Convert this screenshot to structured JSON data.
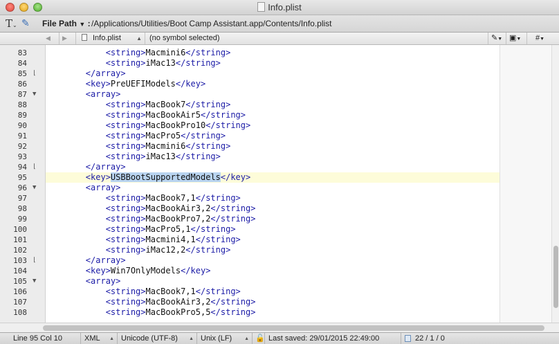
{
  "window": {
    "title": "Info.plist"
  },
  "pathbar": {
    "label": "File Path",
    "separator": ":",
    "value": "/Applications/Utilities/Boot Camp Assistant.app/Contents/Info.plist"
  },
  "navbar": {
    "back_arrow": "◀",
    "forward_arrow": "▶",
    "file": "Info.plist",
    "symbol": "(no symbol selected)",
    "right_tools": [
      "✎",
      "▣",
      "#"
    ]
  },
  "lines": [
    {
      "num": "83",
      "fold": "",
      "indent": "        ",
      "open": "<string>",
      "content": "Macmini6",
      "close": "</string>"
    },
    {
      "num": "84",
      "fold": "",
      "indent": "        ",
      "open": "<string>",
      "content": "iMac13",
      "close": "</string>"
    },
    {
      "num": "85",
      "fold": "⌊",
      "indent": "    ",
      "open": "</array>",
      "content": "",
      "close": ""
    },
    {
      "num": "86",
      "fold": "",
      "indent": "    ",
      "open": "<key>",
      "content": "PreUEFIModels",
      "close": "</key>"
    },
    {
      "num": "87",
      "fold": "▼",
      "indent": "    ",
      "open": "<array>",
      "content": "",
      "close": ""
    },
    {
      "num": "88",
      "fold": "",
      "indent": "        ",
      "open": "<string>",
      "content": "MacBook7",
      "close": "</string>"
    },
    {
      "num": "89",
      "fold": "",
      "indent": "        ",
      "open": "<string>",
      "content": "MacBookAir5",
      "close": "</string>"
    },
    {
      "num": "90",
      "fold": "",
      "indent": "        ",
      "open": "<string>",
      "content": "MacBookPro10",
      "close": "</string>"
    },
    {
      "num": "91",
      "fold": "",
      "indent": "        ",
      "open": "<string>",
      "content": "MacPro5",
      "close": "</string>"
    },
    {
      "num": "92",
      "fold": "",
      "indent": "        ",
      "open": "<string>",
      "content": "Macmini6",
      "close": "</string>"
    },
    {
      "num": "93",
      "fold": "",
      "indent": "        ",
      "open": "<string>",
      "content": "iMac13",
      "close": "</string>"
    },
    {
      "num": "94",
      "fold": "⌊",
      "indent": "    ",
      "open": "</array>",
      "content": "",
      "close": ""
    },
    {
      "num": "95",
      "fold": "",
      "indent": "    ",
      "open": "<key>",
      "content": "USBBootSupportedModels",
      "close": "</key>",
      "current": true,
      "selected": true
    },
    {
      "num": "96",
      "fold": "▼",
      "indent": "    ",
      "open": "<array>",
      "content": "",
      "close": ""
    },
    {
      "num": "97",
      "fold": "",
      "indent": "        ",
      "open": "<string>",
      "content": "MacBook7,1",
      "close": "</string>"
    },
    {
      "num": "98",
      "fold": "",
      "indent": "        ",
      "open": "<string>",
      "content": "MacBookAir3,2",
      "close": "</string>"
    },
    {
      "num": "99",
      "fold": "",
      "indent": "        ",
      "open": "<string>",
      "content": "MacBookPro7,2",
      "close": "</string>"
    },
    {
      "num": "100",
      "fold": "",
      "indent": "        ",
      "open": "<string>",
      "content": "MacPro5,1",
      "close": "</string>"
    },
    {
      "num": "101",
      "fold": "",
      "indent": "        ",
      "open": "<string>",
      "content": "Macmini4,1",
      "close": "</string>"
    },
    {
      "num": "102",
      "fold": "",
      "indent": "        ",
      "open": "<string>",
      "content": "iMac12,2",
      "close": "</string>"
    },
    {
      "num": "103",
      "fold": "⌊",
      "indent": "    ",
      "open": "</array>",
      "content": "",
      "close": ""
    },
    {
      "num": "104",
      "fold": "",
      "indent": "    ",
      "open": "<key>",
      "content": "Win7OnlyModels",
      "close": "</key>"
    },
    {
      "num": "105",
      "fold": "▼",
      "indent": "    ",
      "open": "<array>",
      "content": "",
      "close": ""
    },
    {
      "num": "106",
      "fold": "",
      "indent": "        ",
      "open": "<string>",
      "content": "MacBook7,1",
      "close": "</string>"
    },
    {
      "num": "107",
      "fold": "",
      "indent": "        ",
      "open": "<string>",
      "content": "MacBookAir3,2",
      "close": "</string>"
    },
    {
      "num": "108",
      "fold": "",
      "indent": "        ",
      "open": "<string>",
      "content": "MacBookPro5,5",
      "close": "</string>"
    }
  ],
  "statusbar": {
    "position": "Line 95 Col 10",
    "language": "XML",
    "encoding": "Unicode (UTF-8)",
    "line_endings": "Unix (LF)",
    "last_saved": "Last saved: 29/01/2015 22:49:00",
    "counts": "22 / 1 / 0"
  },
  "colors": {
    "tag": "#1a1aa6",
    "current_line": "#fdfcd9",
    "selection": "#b9d4f0"
  }
}
